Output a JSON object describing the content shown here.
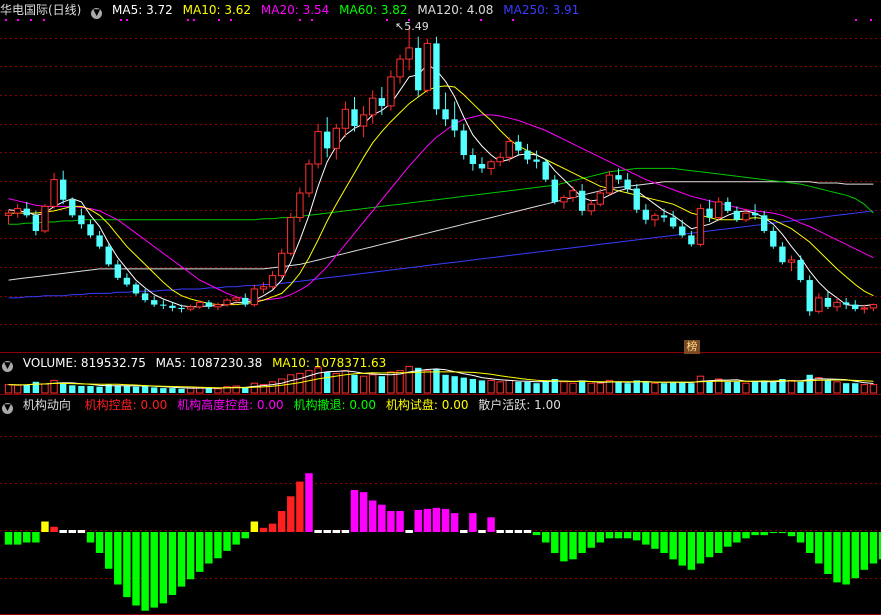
{
  "main_panel": {
    "title": "华电国际(日线)",
    "ma_labels": [
      {
        "text": "MA5: 3.72",
        "color": "#ffffff"
      },
      {
        "text": "MA10: 3.62",
        "color": "#ffff00"
      },
      {
        "text": "MA20: 3.54",
        "color": "#ff00ff"
      },
      {
        "text": "MA60: 3.82",
        "color": "#00ff00"
      },
      {
        "text": "MA120: 4.08",
        "color": "#dddddd"
      },
      {
        "text": "MA250: 3.91",
        "color": "#3b3bff"
      }
    ],
    "peak_label": "5.49",
    "badge": "榜"
  },
  "volume_panel": {
    "labels": [
      {
        "text": "VOLUME: 819532.75",
        "color": "#ffffff"
      },
      {
        "text": "MA5: 1087230.38",
        "color": "#ffffff"
      },
      {
        "text": "MA10: 1078371.63",
        "color": "#ffff00"
      }
    ]
  },
  "indicator_panel": {
    "labels": [
      {
        "text": "机构动向",
        "color": "#dddddd"
      },
      {
        "text": "机构控盘: 0.00",
        "color": "#ff2020"
      },
      {
        "text": "机构高度控盘: 0.00",
        "color": "#ff00ff"
      },
      {
        "text": "机构撤退: 0.00",
        "color": "#00ff00"
      },
      {
        "text": "机构试盘: 0.00",
        "color": "#ffff00"
      },
      {
        "text": "散户活跃: 1.00",
        "color": "#dddddd"
      }
    ]
  },
  "colors": {
    "up": "#ff3030",
    "down": "#54ffff",
    "grid": "#8b0000"
  },
  "chart_data": {
    "type": "candlestick",
    "ohlc": [
      [
        3.8,
        3.85,
        3.72,
        3.82
      ],
      [
        3.82,
        3.9,
        3.78,
        3.86
      ],
      [
        3.86,
        3.92,
        3.78,
        3.8
      ],
      [
        3.8,
        3.84,
        3.62,
        3.66
      ],
      [
        3.66,
        3.9,
        3.64,
        3.88
      ],
      [
        3.88,
        4.18,
        3.86,
        4.12
      ],
      [
        4.12,
        4.2,
        3.9,
        3.94
      ],
      [
        3.94,
        3.96,
        3.78,
        3.8
      ],
      [
        3.8,
        3.86,
        3.68,
        3.72
      ],
      [
        3.72,
        3.76,
        3.6,
        3.62
      ],
      [
        3.62,
        3.66,
        3.5,
        3.52
      ],
      [
        3.52,
        3.54,
        3.34,
        3.36
      ],
      [
        3.36,
        3.4,
        3.22,
        3.24
      ],
      [
        3.24,
        3.28,
        3.16,
        3.18
      ],
      [
        3.18,
        3.2,
        3.08,
        3.1
      ],
      [
        3.1,
        3.14,
        3.02,
        3.04
      ],
      [
        3.04,
        3.08,
        2.98,
        3.0
      ],
      [
        3.0,
        3.04,
        2.96,
        2.99
      ],
      [
        2.99,
        3.02,
        2.94,
        2.97
      ],
      [
        2.97,
        3.0,
        2.93,
        2.96
      ],
      [
        2.96,
        3.0,
        2.94,
        2.98
      ],
      [
        2.98,
        3.04,
        2.96,
        3.02
      ],
      [
        3.02,
        3.04,
        2.96,
        2.98
      ],
      [
        2.98,
        3.02,
        2.95,
        3.0
      ],
      [
        3.0,
        3.06,
        2.98,
        3.04
      ],
      [
        3.04,
        3.08,
        3.0,
        3.06
      ],
      [
        3.06,
        3.1,
        2.98,
        3.0
      ],
      [
        3.0,
        3.18,
        2.98,
        3.14
      ],
      [
        3.14,
        3.2,
        3.1,
        3.16
      ],
      [
        3.16,
        3.3,
        3.14,
        3.26
      ],
      [
        3.26,
        3.5,
        3.24,
        3.46
      ],
      [
        3.46,
        3.82,
        3.44,
        3.78
      ],
      [
        3.78,
        4.05,
        3.74,
        4.0
      ],
      [
        4.0,
        4.3,
        3.96,
        4.26
      ],
      [
        4.26,
        4.62,
        4.22,
        4.55
      ],
      [
        4.55,
        4.68,
        4.32,
        4.4
      ],
      [
        4.4,
        4.62,
        4.3,
        4.58
      ],
      [
        4.58,
        4.82,
        4.5,
        4.75
      ],
      [
        4.75,
        4.86,
        4.55,
        4.6
      ],
      [
        4.6,
        4.78,
        4.5,
        4.7
      ],
      [
        4.7,
        4.92,
        4.62,
        4.85
      ],
      [
        4.85,
        4.95,
        4.7,
        4.78
      ],
      [
        4.78,
        5.1,
        4.74,
        5.04
      ],
      [
        5.04,
        5.24,
        4.98,
        5.2
      ],
      [
        5.2,
        5.49,
        5.1,
        5.3
      ],
      [
        5.3,
        5.4,
        4.86,
        4.92
      ],
      [
        4.92,
        5.38,
        4.9,
        5.34
      ],
      [
        5.34,
        5.4,
        4.7,
        4.75
      ],
      [
        4.75,
        4.9,
        4.6,
        4.66
      ],
      [
        4.66,
        4.82,
        4.5,
        4.56
      ],
      [
        4.56,
        4.62,
        4.3,
        4.34
      ],
      [
        4.34,
        4.4,
        4.2,
        4.26
      ],
      [
        4.26,
        4.32,
        4.18,
        4.22
      ],
      [
        4.22,
        4.3,
        4.16,
        4.28
      ],
      [
        4.28,
        4.36,
        4.24,
        4.32
      ],
      [
        4.32,
        4.5,
        4.28,
        4.46
      ],
      [
        4.46,
        4.52,
        4.34,
        4.38
      ],
      [
        4.38,
        4.44,
        4.26,
        4.3
      ],
      [
        4.3,
        4.38,
        4.22,
        4.28
      ],
      [
        4.28,
        4.3,
        4.1,
        4.12
      ],
      [
        4.12,
        4.16,
        3.9,
        3.92
      ],
      [
        3.92,
        3.98,
        3.86,
        3.96
      ],
      [
        3.96,
        4.06,
        3.92,
        4.02
      ],
      [
        4.02,
        4.08,
        3.8,
        3.84
      ],
      [
        3.84,
        3.94,
        3.8,
        3.9
      ],
      [
        3.9,
        4.04,
        3.88,
        4.0
      ],
      [
        4.0,
        4.2,
        3.98,
        4.16
      ],
      [
        4.16,
        4.22,
        4.08,
        4.12
      ],
      [
        4.12,
        4.18,
        4.0,
        4.04
      ],
      [
        4.04,
        4.08,
        3.82,
        3.85
      ],
      [
        3.85,
        3.9,
        3.72,
        3.76
      ],
      [
        3.76,
        3.82,
        3.7,
        3.8
      ],
      [
        3.8,
        3.86,
        3.74,
        3.78
      ],
      [
        3.78,
        3.84,
        3.68,
        3.7
      ],
      [
        3.7,
        3.76,
        3.6,
        3.62
      ],
      [
        3.62,
        3.66,
        3.52,
        3.54
      ],
      [
        3.54,
        3.9,
        3.52,
        3.86
      ],
      [
        3.86,
        3.94,
        3.74,
        3.78
      ],
      [
        3.78,
        3.96,
        3.76,
        3.92
      ],
      [
        3.92,
        3.96,
        3.82,
        3.84
      ],
      [
        3.84,
        3.88,
        3.74,
        3.76
      ],
      [
        3.76,
        3.86,
        3.74,
        3.82
      ],
      [
        3.82,
        3.9,
        3.76,
        3.8
      ],
      [
        3.8,
        3.84,
        3.64,
        3.66
      ],
      [
        3.66,
        3.7,
        3.5,
        3.52
      ],
      [
        3.52,
        3.56,
        3.36,
        3.38
      ],
      [
        3.38,
        3.44,
        3.3,
        3.4
      ],
      [
        3.4,
        3.44,
        3.2,
        3.22
      ],
      [
        3.22,
        3.26,
        2.9,
        2.94
      ],
      [
        2.94,
        3.1,
        2.92,
        3.06
      ],
      [
        3.06,
        3.12,
        2.96,
        2.98
      ],
      [
        2.98,
        3.06,
        2.94,
        3.02
      ],
      [
        3.02,
        3.06,
        2.96,
        3.0
      ],
      [
        3.0,
        3.04,
        2.94,
        2.96
      ],
      [
        2.96,
        3.0,
        2.92,
        2.97
      ],
      [
        2.97,
        3.01,
        2.94,
        3.0
      ]
    ],
    "ma5": [
      3.85,
      3.84,
      3.83,
      3.8,
      3.82,
      3.88,
      3.92,
      3.95,
      3.92,
      3.8,
      3.7,
      3.55,
      3.42,
      3.32,
      3.22,
      3.15,
      3.09,
      3.05,
      3.02,
      2.99,
      2.98,
      2.98,
      2.99,
      2.99,
      3.0,
      3.02,
      3.02,
      3.04,
      3.08,
      3.13,
      3.22,
      3.38,
      3.58,
      3.8,
      4.06,
      4.28,
      4.42,
      4.52,
      4.58,
      4.62,
      4.7,
      4.74,
      4.8,
      4.92,
      5.04,
      5.06,
      5.15,
      5.1,
      5.0,
      4.86,
      4.68,
      4.52,
      4.42,
      4.34,
      4.28,
      4.3,
      4.34,
      4.35,
      4.34,
      4.3,
      4.2,
      4.12,
      4.04,
      3.96,
      3.93,
      3.94,
      3.98,
      4.02,
      4.04,
      4.02,
      3.96,
      3.9,
      3.84,
      3.8,
      3.74,
      3.68,
      3.7,
      3.72,
      3.76,
      3.8,
      3.83,
      3.84,
      3.82,
      3.78,
      3.72,
      3.63,
      3.52,
      3.42,
      3.3,
      3.2,
      3.12,
      3.06,
      3.0,
      2.99,
      2.99,
      3.0
    ],
    "ma10": [
      3.82,
      3.82,
      3.82,
      3.82,
      3.83,
      3.84,
      3.86,
      3.88,
      3.88,
      3.85,
      3.8,
      3.72,
      3.62,
      3.52,
      3.44,
      3.36,
      3.28,
      3.2,
      3.13,
      3.08,
      3.05,
      3.03,
      3.01,
      3.0,
      3.0,
      3.0,
      3.01,
      3.02,
      3.04,
      3.07,
      3.1,
      3.18,
      3.28,
      3.42,
      3.58,
      3.75,
      3.9,
      4.04,
      4.18,
      4.32,
      4.45,
      4.55,
      4.64,
      4.72,
      4.8,
      4.86,
      4.92,
      4.95,
      4.96,
      4.95,
      4.88,
      4.8,
      4.72,
      4.65,
      4.56,
      4.48,
      4.42,
      4.38,
      4.34,
      4.3,
      4.26,
      4.22,
      4.18,
      4.14,
      4.1,
      4.06,
      4.04,
      4.02,
      4.0,
      3.98,
      3.96,
      3.94,
      3.92,
      3.9,
      3.86,
      3.82,
      3.8,
      3.78,
      3.76,
      3.76,
      3.76,
      3.77,
      3.78,
      3.77,
      3.76,
      3.72,
      3.68,
      3.62,
      3.56,
      3.48,
      3.4,
      3.32,
      3.25,
      3.18,
      3.12,
      3.08
    ],
    "ma20": [
      3.95,
      3.93,
      3.91,
      3.89,
      3.88,
      3.88,
      3.88,
      3.88,
      3.87,
      3.86,
      3.84,
      3.8,
      3.76,
      3.7,
      3.64,
      3.58,
      3.52,
      3.46,
      3.4,
      3.34,
      3.28,
      3.22,
      3.18,
      3.14,
      3.1,
      3.07,
      3.05,
      3.04,
      3.04,
      3.05,
      3.06,
      3.09,
      3.13,
      3.18,
      3.26,
      3.34,
      3.44,
      3.54,
      3.64,
      3.74,
      3.84,
      3.94,
      4.04,
      4.14,
      4.24,
      4.33,
      4.42,
      4.5,
      4.56,
      4.62,
      4.66,
      4.68,
      4.7,
      4.7,
      4.69,
      4.67,
      4.65,
      4.62,
      4.59,
      4.56,
      4.52,
      4.48,
      4.44,
      4.4,
      4.36,
      4.32,
      4.28,
      4.24,
      4.2,
      4.16,
      4.12,
      4.09,
      4.06,
      4.03,
      4.0,
      3.97,
      3.95,
      3.93,
      3.91,
      3.89,
      3.87,
      3.85,
      3.84,
      3.83,
      3.82,
      3.8,
      3.77,
      3.73,
      3.7,
      3.66,
      3.62,
      3.58,
      3.54,
      3.5,
      3.46,
      3.42
    ],
    "ma60": [
      3.72,
      3.72,
      3.73,
      3.73,
      3.74,
      3.74,
      3.75,
      3.75,
      3.76,
      3.76,
      3.76,
      3.76,
      3.76,
      3.76,
      3.76,
      3.76,
      3.76,
      3.76,
      3.76,
      3.76,
      3.76,
      3.76,
      3.76,
      3.76,
      3.76,
      3.76,
      3.76,
      3.76,
      3.77,
      3.77,
      3.78,
      3.78,
      3.79,
      3.8,
      3.81,
      3.82,
      3.83,
      3.84,
      3.85,
      3.86,
      3.87,
      3.88,
      3.89,
      3.9,
      3.91,
      3.92,
      3.93,
      3.94,
      3.95,
      3.96,
      3.97,
      3.98,
      3.99,
      4.0,
      4.01,
      4.02,
      4.03,
      4.04,
      4.05,
      4.06,
      4.07,
      4.09,
      4.11,
      4.13,
      4.15,
      4.17,
      4.19,
      4.2,
      4.21,
      4.22,
      4.22,
      4.22,
      4.22,
      4.22,
      4.21,
      4.2,
      4.19,
      4.18,
      4.17,
      4.16,
      4.15,
      4.14,
      4.13,
      4.12,
      4.11,
      4.1,
      4.09,
      4.08,
      4.06,
      4.04,
      4.02,
      4.0,
      3.98,
      3.95,
      3.9,
      3.82
    ],
    "ma120": [
      3.22,
      3.23,
      3.24,
      3.25,
      3.26,
      3.27,
      3.28,
      3.29,
      3.3,
      3.31,
      3.32,
      3.32,
      3.32,
      3.32,
      3.32,
      3.32,
      3.32,
      3.32,
      3.32,
      3.32,
      3.32,
      3.32,
      3.32,
      3.32,
      3.32,
      3.32,
      3.32,
      3.32,
      3.32,
      3.33,
      3.34,
      3.35,
      3.36,
      3.38,
      3.4,
      3.42,
      3.44,
      3.46,
      3.48,
      3.5,
      3.52,
      3.54,
      3.56,
      3.58,
      3.6,
      3.62,
      3.64,
      3.66,
      3.68,
      3.7,
      3.72,
      3.74,
      3.76,
      3.78,
      3.8,
      3.82,
      3.84,
      3.86,
      3.88,
      3.9,
      3.92,
      3.94,
      3.96,
      3.98,
      4.0,
      4.02,
      4.04,
      4.05,
      4.06,
      4.07,
      4.08,
      4.09,
      4.1,
      4.1,
      4.1,
      4.1,
      4.1,
      4.1,
      4.1,
      4.1,
      4.1,
      4.1,
      4.1,
      4.1,
      4.1,
      4.1,
      4.1,
      4.1,
      4.1,
      4.09,
      4.09,
      4.09,
      4.08,
      4.08,
      4.08,
      4.08
    ],
    "ma250": [
      3.06,
      3.06,
      3.07,
      3.07,
      3.08,
      3.08,
      3.08,
      3.09,
      3.09,
      3.1,
      3.1,
      3.1,
      3.11,
      3.11,
      3.12,
      3.12,
      3.12,
      3.13,
      3.13,
      3.14,
      3.14,
      3.14,
      3.15,
      3.15,
      3.16,
      3.16,
      3.17,
      3.17,
      3.18,
      3.18,
      3.19,
      3.2,
      3.21,
      3.22,
      3.23,
      3.24,
      3.25,
      3.26,
      3.27,
      3.28,
      3.29,
      3.3,
      3.31,
      3.32,
      3.33,
      3.34,
      3.35,
      3.36,
      3.37,
      3.38,
      3.39,
      3.4,
      3.41,
      3.42,
      3.43,
      3.44,
      3.45,
      3.46,
      3.47,
      3.48,
      3.49,
      3.5,
      3.51,
      3.52,
      3.53,
      3.54,
      3.55,
      3.56,
      3.57,
      3.58,
      3.59,
      3.6,
      3.61,
      3.62,
      3.63,
      3.64,
      3.65,
      3.66,
      3.67,
      3.68,
      3.69,
      3.7,
      3.71,
      3.72,
      3.73,
      3.74,
      3.75,
      3.76,
      3.77,
      3.78,
      3.79,
      3.8,
      3.81,
      3.82,
      3.83,
      3.84
    ],
    "volume": [
      0.6,
      0.55,
      0.6,
      0.8,
      0.65,
      0.9,
      0.7,
      0.55,
      0.5,
      0.5,
      0.45,
      0.6,
      0.55,
      0.5,
      0.45,
      0.5,
      0.4,
      0.35,
      0.35,
      0.3,
      0.35,
      0.4,
      0.35,
      0.3,
      0.45,
      0.5,
      0.4,
      0.7,
      0.6,
      0.8,
      1.0,
      1.3,
      1.4,
      1.6,
      1.8,
      1.5,
      1.4,
      1.6,
      1.3,
      1.2,
      1.3,
      1.2,
      1.5,
      1.6,
      1.9,
      1.8,
      1.6,
      1.7,
      1.3,
      1.2,
      1.1,
      1.0,
      0.9,
      0.9,
      0.8,
      0.9,
      0.8,
      0.8,
      0.7,
      0.9,
      1.0,
      0.8,
      0.7,
      0.9,
      0.7,
      0.7,
      0.9,
      0.8,
      0.7,
      0.9,
      0.8,
      0.7,
      0.7,
      0.8,
      0.8,
      0.7,
      1.2,
      0.9,
      1.0,
      0.8,
      0.8,
      0.7,
      0.8,
      0.9,
      0.8,
      1.0,
      0.9,
      0.8,
      1.3,
      1.1,
      0.9,
      0.8,
      0.7,
      0.7,
      0.6,
      0.6
    ],
    "indicator": [
      -12,
      -12,
      -10,
      -10,
      10,
      5,
      -1,
      -1,
      -1,
      -10,
      -20,
      -35,
      -50,
      -62,
      -70,
      -75,
      -72,
      -68,
      -60,
      -52,
      -45,
      -38,
      -30,
      -25,
      -18,
      -12,
      -6,
      10,
      4,
      8,
      20,
      34,
      48,
      56,
      2,
      2,
      2,
      -1,
      40,
      38,
      30,
      26,
      20,
      20,
      -1,
      21,
      22,
      23,
      22,
      18,
      -1,
      18,
      -1,
      14,
      -1,
      -1,
      -1,
      -1,
      -3,
      -10,
      -20,
      -28,
      -26,
      -20,
      -15,
      -10,
      -6,
      -6,
      -6,
      -8,
      -12,
      -16,
      -20,
      -26,
      -32,
      -36,
      -30,
      -24,
      -20,
      -14,
      -10,
      -6,
      -3,
      -3,
      -1,
      -1,
      -4,
      -10,
      -20,
      -30,
      -40,
      -48,
      -50,
      -44,
      -36,
      -30,
      -26,
      -22,
      -20,
      -20
    ],
    "indicator_colors": [
      "g",
      "g",
      "g",
      "g",
      "y",
      "r",
      "w",
      "w",
      "w",
      "g",
      "g",
      "g",
      "g",
      "g",
      "g",
      "g",
      "g",
      "g",
      "g",
      "g",
      "g",
      "g",
      "g",
      "g",
      "g",
      "g",
      "g",
      "y",
      "r",
      "r",
      "r",
      "r",
      "r",
      "m",
      "w",
      "w",
      "w",
      "w",
      "m",
      "m",
      "m",
      "m",
      "m",
      "m",
      "w",
      "m",
      "m",
      "m",
      "m",
      "m",
      "w",
      "m",
      "w",
      "m",
      "w",
      "w",
      "w",
      "w",
      "g",
      "g",
      "g",
      "g",
      "g",
      "g",
      "g",
      "g",
      "g",
      "g",
      "g",
      "g",
      "g",
      "g",
      "g",
      "g",
      "g",
      "g",
      "g",
      "g",
      "g",
      "g",
      "g",
      "g",
      "g",
      "g",
      "g",
      "g",
      "g",
      "g",
      "g",
      "g",
      "g",
      "g",
      "g",
      "g",
      "g",
      "g",
      "g",
      "g",
      "g",
      "g"
    ]
  }
}
